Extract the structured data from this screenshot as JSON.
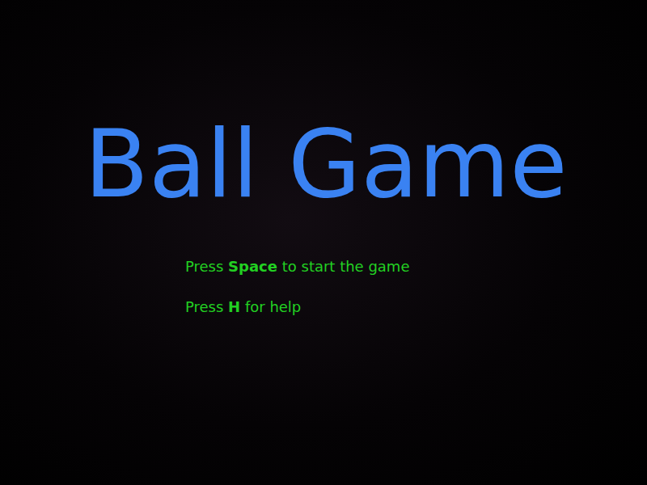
{
  "title": "Ball Game",
  "instructions": [
    {
      "prefix": "Press ",
      "key": "Space",
      "suffix": " to start the game"
    },
    {
      "prefix": "Press ",
      "key": "H",
      "suffix": " for help"
    }
  ]
}
